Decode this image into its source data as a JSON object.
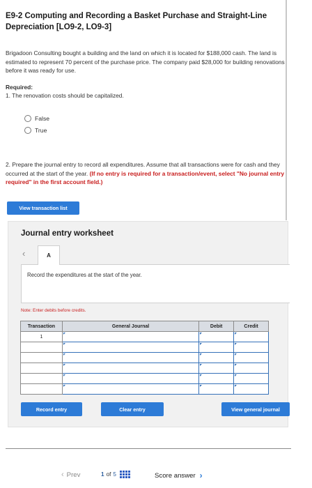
{
  "header": {
    "title": "E9-2 Computing and Recording a Basket Purchase and Straight-Line Depreciation [LO9-2, LO9-3]"
  },
  "problem": {
    "paragraph": "Brigadoon Consulting bought a building and the land on which it is located for $188,000 cash. The land is estimated to represent 70 percent of the purchase price. The company paid $28,000 for building renovations before it was ready for use.",
    "required_label": "Required:",
    "q1": "1. The renovation costs should be capitalized.",
    "options": [
      "False",
      "True"
    ],
    "q2_text": "2. Prepare the journal entry to record all expenditures. Assume that all transactions were for cash and they occurred at the start of the year. ",
    "q2_note": "(If no entry is required for a transaction/event, select \"No journal entry required\" in the first account field.)"
  },
  "buttons": {
    "view_transactions": "View transaction list",
    "record_entry": "Record entry",
    "clear_entry": "Clear entry",
    "view_general_journal": "View general journal"
  },
  "worksheet": {
    "title": "Journal entry worksheet",
    "tab_label": "A",
    "instruction": "Record the expenditures at the start of the year.",
    "note": "Note: Enter debits before credits.",
    "columns": [
      "Transaction",
      "General Journal",
      "Debit",
      "Credit"
    ],
    "rows": [
      {
        "transaction": "1"
      },
      {
        "transaction": ""
      },
      {
        "transaction": ""
      },
      {
        "transaction": ""
      },
      {
        "transaction": ""
      },
      {
        "transaction": ""
      }
    ]
  },
  "navigation": {
    "prev": "Prev",
    "current_page": "1",
    "of_label": "of",
    "total_pages": "5",
    "score_answer": "Score answer"
  },
  "icons": {
    "prev": "chevron-left-icon",
    "grid": "grid-icon",
    "next": "chevron-right-icon"
  },
  "colors": {
    "accent": "#2d7bd7",
    "note_red": "#c81e1e"
  }
}
